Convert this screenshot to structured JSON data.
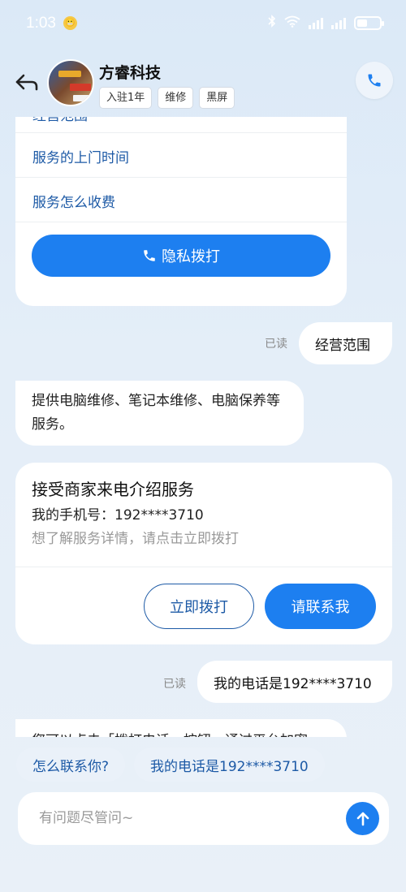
{
  "status": {
    "time": "1:03",
    "emoji": "😬",
    "battery_level": 0.45
  },
  "header": {
    "shop_name": "方睿科技",
    "tags": [
      "入驻1年",
      "维修",
      "黑屏"
    ]
  },
  "faq_card": {
    "items": [
      "经营范围",
      "服务的上门时间",
      "服务怎么收费"
    ],
    "dial_label": "隐私拨打"
  },
  "messages": {
    "read_label": "已读",
    "user_msg_1": "经营范围",
    "bot_reply_1": "提供电脑维修、笔记本维修、电脑保养等服务。",
    "service_card": {
      "title": "接受商家来电介绍服务",
      "phone_line": "我的手机号：192****3710",
      "hint": "想了解服务详情，请点击立即拨打",
      "call_now": "立即拨打",
      "contact_me": "请联系我"
    },
    "user_msg_2": "我的电话是192****3710",
    "bot_partial": "您可以点击「拨打电话」按钮，通过平台加密"
  },
  "quick_replies": [
    "怎么联系你?",
    "我的电话是192****3710"
  ],
  "input": {
    "placeholder": "有问题尽管问~"
  },
  "colors": {
    "accent": "#1d7ff0",
    "link": "#1d5aa6",
    "background": "#e4eef8"
  }
}
